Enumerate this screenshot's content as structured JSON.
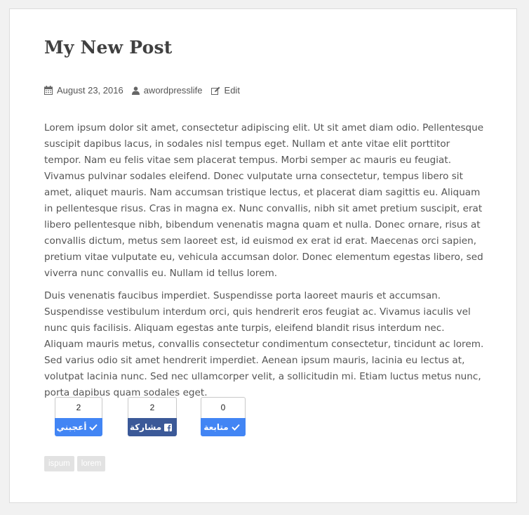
{
  "post": {
    "title": "My New Post",
    "meta": {
      "date": "August 23, 2016",
      "author": "awordpresslife",
      "edit_label": "Edit"
    },
    "paragraphs": [
      "Lorem ipsum dolor sit amet, consectetur adipiscing elit. Ut sit amet diam odio. Pellentesque suscipit dapibus lacus, in sodales nisl tempus eget. Nullam et ante vitae elit porttitor tempor. Nam eu felis vitae sem placerat tempus. Morbi semper ac mauris eu feugiat. Vivamus pulvinar sodales eleifend. Donec vulputate urna consectetur, tempus libero sit amet, aliquet mauris. Nam accumsan tristique lectus, et placerat diam sagittis eu. Aliquam in pellentesque risus. Cras in magna ex. Nunc convallis, nibh sit amet pretium suscipit, erat libero pellentesque nibh, bibendum venenatis magna quam et nulla. Donec ornare, risus at convallis dictum, metus sem laoreet est, id euismod ex erat id erat. Maecenas orci sapien, pretium vitae vulputate eu, vehicula accumsan dolor. Donec elementum egestas libero, sed viverra nunc convallis eu. Nullam id tellus lorem.",
      "Duis venenatis faucibus imperdiet. Suspendisse porta laoreet mauris et accumsan. Suspendisse vestibulum interdum orci, quis hendrerit eros feugiat ac. Vivamus iaculis vel nunc quis facilisis. Aliquam egestas ante turpis, eleifend blandit risus interdum nec. Aliquam mauris metus, convallis consectetur condimentum consectetur, tincidunt ac lorem. Sed varius odio sit amet hendrerit imperdiet. Aenean ipsum mauris, lacinia eu lectus at, volutpat lacinia nunc. Sed nec ullamcorper velit, a sollicitudin mi. Etiam luctus metus nunc, porta dapibus quam sodales eget."
    ]
  },
  "share_buttons": [
    {
      "count": "2",
      "label": "أعجبني",
      "icon": "check-icon",
      "color": "#4285f4"
    },
    {
      "count": "2",
      "label": "مشاركة",
      "icon": "facebook-icon",
      "color": "#3b5998"
    },
    {
      "count": "0",
      "label": "متابعة",
      "icon": "check-icon",
      "color": "#4285f4"
    }
  ],
  "tags": [
    "ispum",
    "lorem"
  ],
  "colors": {
    "background": "#f1f1f1",
    "card": "#ffffff",
    "text": "#555555",
    "title": "#404040",
    "tag_bg": "#e2e2e2"
  }
}
